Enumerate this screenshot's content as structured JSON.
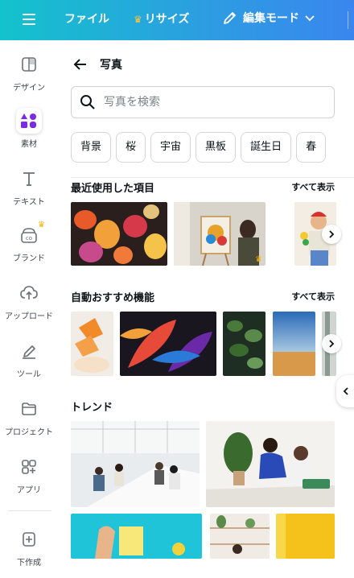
{
  "topbar": {
    "file_label": "ファイル",
    "resize_label": "リサイズ",
    "edit_mode_label": "編集モード"
  },
  "sidebar": {
    "items": [
      {
        "label": "デザイン",
        "icon": "layout-icon"
      },
      {
        "label": "素材",
        "icon": "elements-icon"
      },
      {
        "label": "テキスト",
        "icon": "text-icon"
      },
      {
        "label": "ブランド",
        "icon": "brand-icon"
      },
      {
        "label": "アップロード",
        "icon": "upload-icon"
      },
      {
        "label": "ツール",
        "icon": "draw-icon"
      },
      {
        "label": "プロジェクト",
        "icon": "folder-icon"
      },
      {
        "label": "アプリ",
        "icon": "apps-icon"
      },
      {
        "label": "下作成",
        "icon": "create-icon"
      }
    ]
  },
  "panel": {
    "title": "写真",
    "search_placeholder": "写真を検索",
    "chips": [
      "背景",
      "桜",
      "宇宙",
      "黒板",
      "誕生日",
      "春"
    ],
    "recent": {
      "title": "最近使用した項目",
      "see_all": "すべて表示"
    },
    "auto": {
      "title": "自動おすすめ機能",
      "see_all": "すべて表示"
    },
    "trend": {
      "title": "トレンド"
    }
  },
  "colors": {
    "topbar_start": "#13c3cc",
    "topbar_end": "#3a86ee",
    "accent_purple": "#7d2ae8",
    "crown": "#ffc53d"
  }
}
